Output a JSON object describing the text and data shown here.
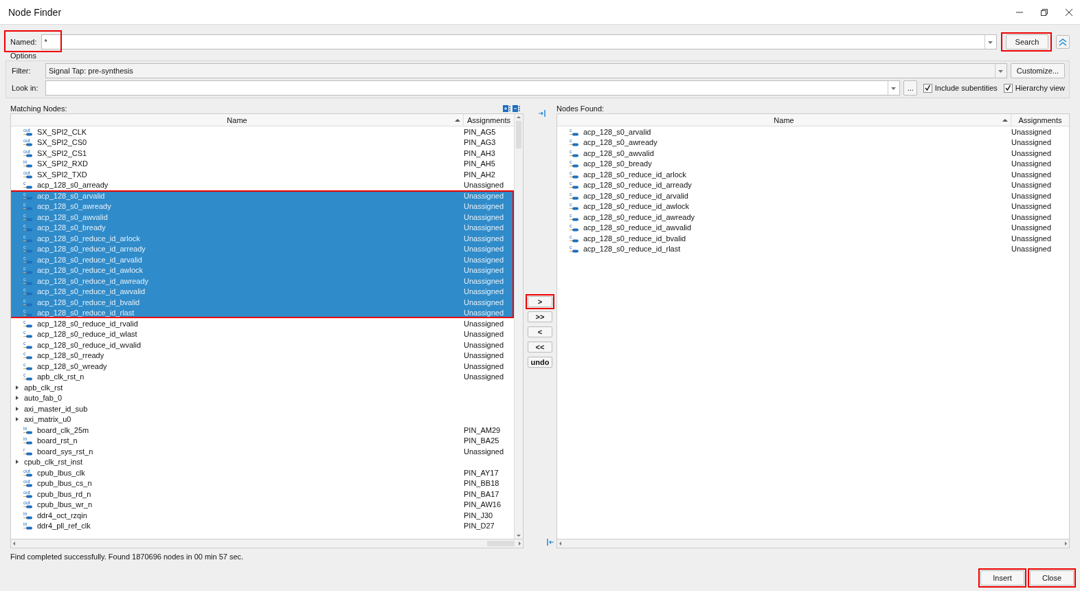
{
  "window": {
    "title": "Node Finder"
  },
  "named": {
    "label": "Named:",
    "value": "*",
    "highlighted": true
  },
  "search_button": {
    "label": "Search",
    "highlighted": true
  },
  "options": {
    "title": "Options",
    "filter": {
      "label": "Filter:",
      "value": "Signal Tap: pre-synthesis"
    },
    "customize_button": "Customize...",
    "look_in": {
      "label": "Look in:"
    },
    "browse_button": "...",
    "checkboxes": [
      {
        "label": "Include subentities",
        "checked": true
      },
      {
        "label": "Hierarchy view",
        "checked": true
      }
    ]
  },
  "matching_nodes": {
    "label": "Matching Nodes:",
    "columns": [
      "Name",
      "Assignments"
    ],
    "selection_highlighted": true,
    "rows": [
      {
        "kind": "node",
        "pin": "out",
        "name": "SX_SPI2_CLK",
        "assignment": "PIN_AG5",
        "selected": false
      },
      {
        "kind": "node",
        "pin": "out",
        "name": "SX_SPI2_CS0",
        "assignment": "PIN_AG3",
        "selected": false
      },
      {
        "kind": "node",
        "pin": "out",
        "name": "SX_SPI2_CS1",
        "assignment": "PIN_AH3",
        "selected": false
      },
      {
        "kind": "node",
        "pin": "in",
        "name": "SX_SPI2_RXD",
        "assignment": "PIN_AH5",
        "selected": false
      },
      {
        "kind": "node",
        "pin": "out",
        "name": "SX_SPI2_TXD",
        "assignment": "PIN_AH2",
        "selected": false
      },
      {
        "kind": "node",
        "pin": "c",
        "name": "acp_128_s0_arready",
        "assignment": "Unassigned",
        "selected": false
      },
      {
        "kind": "node",
        "pin": "c",
        "name": "acp_128_s0_arvalid",
        "assignment": "Unassigned",
        "selected": true
      },
      {
        "kind": "node",
        "pin": "c",
        "name": "acp_128_s0_awready",
        "assignment": "Unassigned",
        "selected": true
      },
      {
        "kind": "node",
        "pin": "c",
        "name": "acp_128_s0_awvalid",
        "assignment": "Unassigned",
        "selected": true
      },
      {
        "kind": "node",
        "pin": "c",
        "name": "acp_128_s0_bready",
        "assignment": "Unassigned",
        "selected": true
      },
      {
        "kind": "node",
        "pin": "c",
        "name": "acp_128_s0_reduce_id_arlock",
        "assignment": "Unassigned",
        "selected": true
      },
      {
        "kind": "node",
        "pin": "c",
        "name": "acp_128_s0_reduce_id_arready",
        "assignment": "Unassigned",
        "selected": true
      },
      {
        "kind": "node",
        "pin": "c",
        "name": "acp_128_s0_reduce_id_arvalid",
        "assignment": "Unassigned",
        "selected": true
      },
      {
        "kind": "node",
        "pin": "c",
        "name": "acp_128_s0_reduce_id_awlock",
        "assignment": "Unassigned",
        "selected": true
      },
      {
        "kind": "node",
        "pin": "c",
        "name": "acp_128_s0_reduce_id_awready",
        "assignment": "Unassigned",
        "selected": true
      },
      {
        "kind": "node",
        "pin": "c",
        "name": "acp_128_s0_reduce_id_awvalid",
        "assignment": "Unassigned",
        "selected": true
      },
      {
        "kind": "node",
        "pin": "c",
        "name": "acp_128_s0_reduce_id_bvalid",
        "assignment": "Unassigned",
        "selected": true
      },
      {
        "kind": "node",
        "pin": "c",
        "name": "acp_128_s0_reduce_id_rlast",
        "assignment": "Unassigned",
        "selected": true
      },
      {
        "kind": "node",
        "pin": "c",
        "name": "acp_128_s0_reduce_id_rvalid",
        "assignment": "Unassigned",
        "selected": false
      },
      {
        "kind": "node",
        "pin": "c",
        "name": "acp_128_s0_reduce_id_wlast",
        "assignment": "Unassigned",
        "selected": false
      },
      {
        "kind": "node",
        "pin": "c",
        "name": "acp_128_s0_reduce_id_wvalid",
        "assignment": "Unassigned",
        "selected": false
      },
      {
        "kind": "node",
        "pin": "c",
        "name": "acp_128_s0_rready",
        "assignment": "Unassigned",
        "selected": false
      },
      {
        "kind": "node",
        "pin": "c",
        "name": "acp_128_s0_wready",
        "assignment": "Unassigned",
        "selected": false
      },
      {
        "kind": "node",
        "pin": "c",
        "name": "apb_clk_rst_n",
        "assignment": "Unassigned",
        "selected": false
      },
      {
        "kind": "group",
        "name": "apb_clk_rst",
        "expanded": false,
        "selected": false
      },
      {
        "kind": "group",
        "name": "auto_fab_0",
        "expanded": false,
        "selected": false
      },
      {
        "kind": "group",
        "name": "axi_master_id_sub",
        "expanded": false,
        "selected": false
      },
      {
        "kind": "group",
        "name": "axi_matrix_u0",
        "expanded": false,
        "selected": false
      },
      {
        "kind": "node",
        "pin": "in",
        "name": "board_clk_25m",
        "assignment": "PIN_AM29",
        "selected": false
      },
      {
        "kind": "node",
        "pin": "in",
        "name": "board_rst_n",
        "assignment": "PIN_BA25",
        "selected": false
      },
      {
        "kind": "node",
        "pin": "r",
        "name": "board_sys_rst_n",
        "assignment": "Unassigned",
        "selected": false
      },
      {
        "kind": "group",
        "name": "cpub_clk_rst_inst",
        "expanded": false,
        "selected": false
      },
      {
        "kind": "node",
        "pin": "out",
        "name": "cpub_lbus_clk",
        "assignment": "PIN_AY17",
        "selected": false
      },
      {
        "kind": "node",
        "pin": "out",
        "name": "cpub_lbus_cs_n",
        "assignment": "PIN_BB18",
        "selected": false
      },
      {
        "kind": "node",
        "pin": "out",
        "name": "cpub_lbus_rd_n",
        "assignment": "PIN_BA17",
        "selected": false
      },
      {
        "kind": "node",
        "pin": "out",
        "name": "cpub_lbus_wr_n",
        "assignment": "PIN_AW16",
        "selected": false
      },
      {
        "kind": "node",
        "pin": "in",
        "name": "ddr4_oct_rzqin",
        "assignment": "PIN_J30",
        "selected": false
      },
      {
        "kind": "node",
        "pin": "in",
        "name": "ddr4_pll_ref_clk",
        "assignment": "PIN_D27",
        "selected": false
      }
    ]
  },
  "transfer_buttons": [
    {
      "label": ">",
      "highlighted": true
    },
    {
      "label": ">>",
      "highlighted": false
    },
    {
      "label": "<",
      "highlighted": false
    },
    {
      "label": "<<",
      "highlighted": false
    },
    {
      "label": "undo",
      "highlighted": false
    }
  ],
  "nodes_found": {
    "label": "Nodes Found:",
    "columns": [
      "Name",
      "Assignments"
    ],
    "rows": [
      {
        "pin": "c",
        "name": "acp_128_s0_arvalid",
        "assignment": "Unassigned"
      },
      {
        "pin": "c",
        "name": "acp_128_s0_awready",
        "assignment": "Unassigned"
      },
      {
        "pin": "c",
        "name": "acp_128_s0_awvalid",
        "assignment": "Unassigned"
      },
      {
        "pin": "c",
        "name": "acp_128_s0_bready",
        "assignment": "Unassigned"
      },
      {
        "pin": "c",
        "name": "acp_128_s0_reduce_id_arlock",
        "assignment": "Unassigned"
      },
      {
        "pin": "c",
        "name": "acp_128_s0_reduce_id_arready",
        "assignment": "Unassigned"
      },
      {
        "pin": "c",
        "name": "acp_128_s0_reduce_id_arvalid",
        "assignment": "Unassigned"
      },
      {
        "pin": "c",
        "name": "acp_128_s0_reduce_id_awlock",
        "assignment": "Unassigned"
      },
      {
        "pin": "c",
        "name": "acp_128_s0_reduce_id_awready",
        "assignment": "Unassigned"
      },
      {
        "pin": "c",
        "name": "acp_128_s0_reduce_id_awvalid",
        "assignment": "Unassigned"
      },
      {
        "pin": "c",
        "name": "acp_128_s0_reduce_id_bvalid",
        "assignment": "Unassigned"
      },
      {
        "pin": "c",
        "name": "acp_128_s0_reduce_id_rlast",
        "assignment": "Unassigned"
      }
    ]
  },
  "status_bar": "Find completed successfully. Found 1870696 nodes in 00 min 57 sec.",
  "buttons": [
    {
      "label": "Insert",
      "highlighted": true
    },
    {
      "label": "Close",
      "highlighted": true
    }
  ]
}
